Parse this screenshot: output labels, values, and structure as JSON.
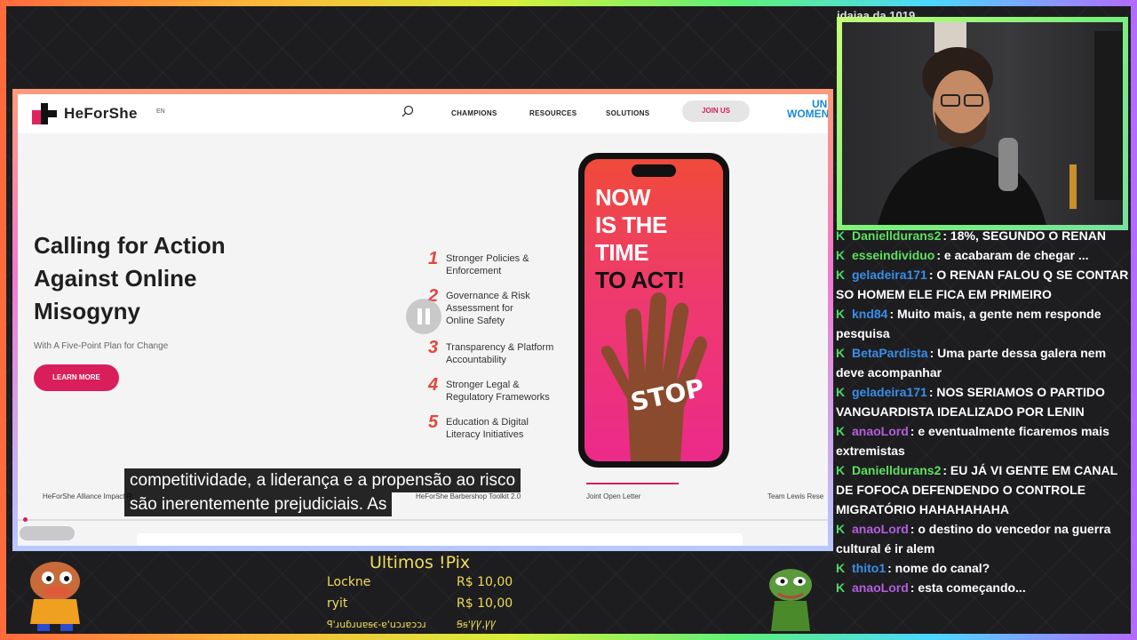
{
  "site": {
    "brand": "HeForShe",
    "lang": "EN",
    "nav": [
      "CHAMPIONS",
      "RESOURCES",
      "SOLUTIONS"
    ],
    "join": "JOIN US",
    "partner": [
      "UN",
      "WOMEN"
    ],
    "hero_title": "Calling for Action Against Online Misogyny",
    "hero_subtitle": "With A Five-Point Plan for Change",
    "learn_more": "LEARN MORE",
    "plan": [
      {
        "num": "1",
        "text": "Stronger Policies & Enforcement"
      },
      {
        "num": "2",
        "text": "Governance & Risk Assessment for Online Safety"
      },
      {
        "num": "3",
        "text": "Transparency & Platform Accountability"
      },
      {
        "num": "4",
        "text": "Stronger Legal & Regulatory Frameworks"
      },
      {
        "num": "5",
        "text": "Education & Digital Literacy Initiatives"
      }
    ],
    "poster": {
      "line1": "NOW",
      "line2": "IS THE",
      "line3": "TIME",
      "line4": "TO ACT!",
      "stop": "STOP"
    },
    "tabs": [
      "HeForShe Alliance Impact R",
      "HeForShe Barbershop Toolkit 2.0",
      "Joint Open Letter",
      "Team Lewis Rese"
    ]
  },
  "subtitles": {
    "line1": "competitividade, a liderança e a propensão ao risco",
    "line2": "são inerentemente prejudiciais.  As"
  },
  "cam_top_text": "idaiaa da 1019",
  "chat": [
    {
      "user": "Danielldurans2",
      "text": ": 18%, SEGUNDO O RENAN",
      "color": "#5ee05e"
    },
    {
      "user": "esseindividuo",
      "text": ": e acabaram de chegar ...",
      "color": "#5ee05e"
    },
    {
      "user": "geladeira171",
      "text": ": O RENAN FALOU Q SE CONTAR SO HOMEM ELE FICA EM PRIMEIRO",
      "color": "#3a8ee8"
    },
    {
      "user": "knd84",
      "text": ": Muito mais, a gente nem responde pesquisa",
      "color": "#3a8ee8"
    },
    {
      "user": "BetaPardista",
      "text": ": Uma parte dessa galera nem deve acompanhar",
      "color": "#3a8ee8"
    },
    {
      "user": "geladeira171",
      "text": ": NOS SERIAMOS O PARTIDO VANGUARDISTA IDEALIZADO POR LENIN",
      "color": "#3a8ee8"
    },
    {
      "user": "anaoLord",
      "text": ": e eventualmente ficaremos mais extremistas",
      "color": "#b45ee0"
    },
    {
      "user": "Danielldurans2",
      "text": ": EU JÁ VI GENTE EM CANAL DE FOFOCA DEFENDENDO O CONTROLE MIGRATÓRIO HAHAHAHAHA",
      "color": "#5ee05e"
    },
    {
      "user": "anaoLord",
      "text": ": o destino do vencedor na guerra cultural é ir alem",
      "color": "#b45ee0"
    },
    {
      "user": "thito1",
      "text": ": nome do canal?",
      "color": "#3a8ee8"
    },
    {
      "user": "anaoLord",
      "text": ": esta começando...",
      "color": "#b45ee0"
    }
  ],
  "pix": {
    "title": "Ultimos !Pix",
    "entries": [
      {
        "name": "Lockne",
        "amount": "R$ 10,00"
      },
      {
        "name": "ryit",
        "amount": "R$ 10,00"
      },
      {
        "name": "ꟼꞌɹuɓɹuɐꞩꞓ-ɐꞌuɔɹɐɔɔɹ",
        "amount": "ꞨꞩꞌꝨꝨ,ꝨꝨ"
      }
    ]
  }
}
